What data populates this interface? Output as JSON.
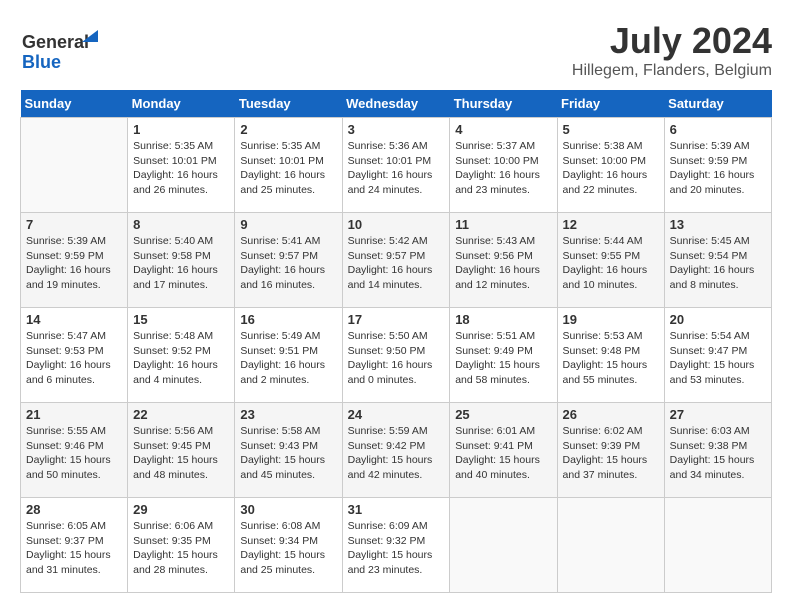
{
  "header": {
    "logo_line1": "General",
    "logo_line2": "Blue",
    "month_year": "July 2024",
    "location": "Hillegem, Flanders, Belgium"
  },
  "weekdays": [
    "Sunday",
    "Monday",
    "Tuesday",
    "Wednesday",
    "Thursday",
    "Friday",
    "Saturday"
  ],
  "weeks": [
    [
      {
        "day": "",
        "info": ""
      },
      {
        "day": "1",
        "info": "Sunrise: 5:35 AM\nSunset: 10:01 PM\nDaylight: 16 hours\nand 26 minutes."
      },
      {
        "day": "2",
        "info": "Sunrise: 5:35 AM\nSunset: 10:01 PM\nDaylight: 16 hours\nand 25 minutes."
      },
      {
        "day": "3",
        "info": "Sunrise: 5:36 AM\nSunset: 10:01 PM\nDaylight: 16 hours\nand 24 minutes."
      },
      {
        "day": "4",
        "info": "Sunrise: 5:37 AM\nSunset: 10:00 PM\nDaylight: 16 hours\nand 23 minutes."
      },
      {
        "day": "5",
        "info": "Sunrise: 5:38 AM\nSunset: 10:00 PM\nDaylight: 16 hours\nand 22 minutes."
      },
      {
        "day": "6",
        "info": "Sunrise: 5:39 AM\nSunset: 9:59 PM\nDaylight: 16 hours\nand 20 minutes."
      }
    ],
    [
      {
        "day": "7",
        "info": "Sunrise: 5:39 AM\nSunset: 9:59 PM\nDaylight: 16 hours\nand 19 minutes."
      },
      {
        "day": "8",
        "info": "Sunrise: 5:40 AM\nSunset: 9:58 PM\nDaylight: 16 hours\nand 17 minutes."
      },
      {
        "day": "9",
        "info": "Sunrise: 5:41 AM\nSunset: 9:57 PM\nDaylight: 16 hours\nand 16 minutes."
      },
      {
        "day": "10",
        "info": "Sunrise: 5:42 AM\nSunset: 9:57 PM\nDaylight: 16 hours\nand 14 minutes."
      },
      {
        "day": "11",
        "info": "Sunrise: 5:43 AM\nSunset: 9:56 PM\nDaylight: 16 hours\nand 12 minutes."
      },
      {
        "day": "12",
        "info": "Sunrise: 5:44 AM\nSunset: 9:55 PM\nDaylight: 16 hours\nand 10 minutes."
      },
      {
        "day": "13",
        "info": "Sunrise: 5:45 AM\nSunset: 9:54 PM\nDaylight: 16 hours\nand 8 minutes."
      }
    ],
    [
      {
        "day": "14",
        "info": "Sunrise: 5:47 AM\nSunset: 9:53 PM\nDaylight: 16 hours\nand 6 minutes."
      },
      {
        "day": "15",
        "info": "Sunrise: 5:48 AM\nSunset: 9:52 PM\nDaylight: 16 hours\nand 4 minutes."
      },
      {
        "day": "16",
        "info": "Sunrise: 5:49 AM\nSunset: 9:51 PM\nDaylight: 16 hours\nand 2 minutes."
      },
      {
        "day": "17",
        "info": "Sunrise: 5:50 AM\nSunset: 9:50 PM\nDaylight: 16 hours\nand 0 minutes."
      },
      {
        "day": "18",
        "info": "Sunrise: 5:51 AM\nSunset: 9:49 PM\nDaylight: 15 hours\nand 58 minutes."
      },
      {
        "day": "19",
        "info": "Sunrise: 5:53 AM\nSunset: 9:48 PM\nDaylight: 15 hours\nand 55 minutes."
      },
      {
        "day": "20",
        "info": "Sunrise: 5:54 AM\nSunset: 9:47 PM\nDaylight: 15 hours\nand 53 minutes."
      }
    ],
    [
      {
        "day": "21",
        "info": "Sunrise: 5:55 AM\nSunset: 9:46 PM\nDaylight: 15 hours\nand 50 minutes."
      },
      {
        "day": "22",
        "info": "Sunrise: 5:56 AM\nSunset: 9:45 PM\nDaylight: 15 hours\nand 48 minutes."
      },
      {
        "day": "23",
        "info": "Sunrise: 5:58 AM\nSunset: 9:43 PM\nDaylight: 15 hours\nand 45 minutes."
      },
      {
        "day": "24",
        "info": "Sunrise: 5:59 AM\nSunset: 9:42 PM\nDaylight: 15 hours\nand 42 minutes."
      },
      {
        "day": "25",
        "info": "Sunrise: 6:01 AM\nSunset: 9:41 PM\nDaylight: 15 hours\nand 40 minutes."
      },
      {
        "day": "26",
        "info": "Sunrise: 6:02 AM\nSunset: 9:39 PM\nDaylight: 15 hours\nand 37 minutes."
      },
      {
        "day": "27",
        "info": "Sunrise: 6:03 AM\nSunset: 9:38 PM\nDaylight: 15 hours\nand 34 minutes."
      }
    ],
    [
      {
        "day": "28",
        "info": "Sunrise: 6:05 AM\nSunset: 9:37 PM\nDaylight: 15 hours\nand 31 minutes."
      },
      {
        "day": "29",
        "info": "Sunrise: 6:06 AM\nSunset: 9:35 PM\nDaylight: 15 hours\nand 28 minutes."
      },
      {
        "day": "30",
        "info": "Sunrise: 6:08 AM\nSunset: 9:34 PM\nDaylight: 15 hours\nand 25 minutes."
      },
      {
        "day": "31",
        "info": "Sunrise: 6:09 AM\nSunset: 9:32 PM\nDaylight: 15 hours\nand 23 minutes."
      },
      {
        "day": "",
        "info": ""
      },
      {
        "day": "",
        "info": ""
      },
      {
        "day": "",
        "info": ""
      }
    ]
  ]
}
